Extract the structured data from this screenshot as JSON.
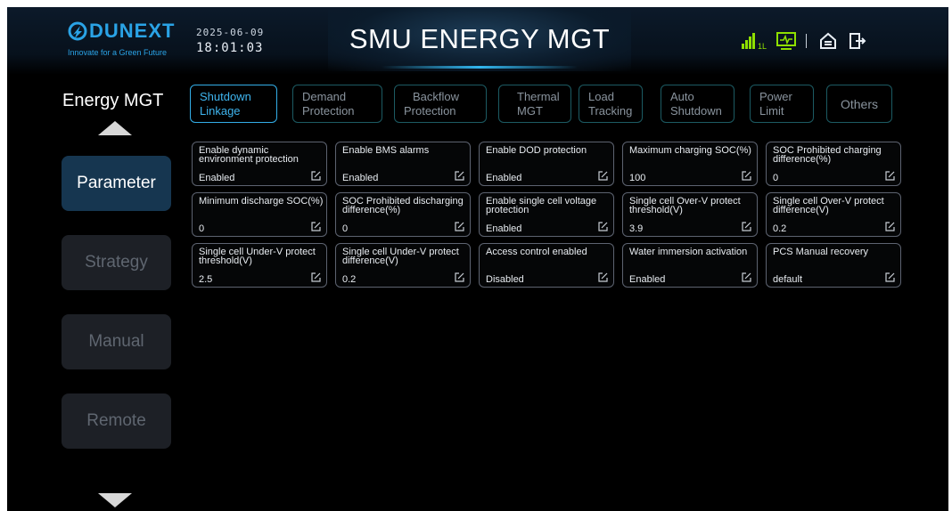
{
  "header": {
    "brand": "DUNEXT",
    "slogan": "Innovate for a Green Future",
    "date": "2025-06-09",
    "time": "18:01:03",
    "title": "SMU ENERGY MGT",
    "signal_label": "1L",
    "icons": [
      "signal-icon",
      "monitor-icon",
      "home-icon",
      "exit-icon"
    ],
    "accent_color": "#2aa3e6",
    "signal_color": "#8fe000"
  },
  "sidebar": {
    "title": "Energy MGT",
    "items": [
      {
        "label": "Parameter",
        "active": true
      },
      {
        "label": "Strategy",
        "active": false
      },
      {
        "label": "Manual",
        "active": false
      },
      {
        "label": "Remote",
        "active": false
      }
    ]
  },
  "tabs": [
    {
      "line1": "Shutdown",
      "line2": "Linkage",
      "active": true
    },
    {
      "line1": "Demand",
      "line2": "Protection",
      "active": false
    },
    {
      "line1": "Backflow",
      "line2": "Protection",
      "active": false
    },
    {
      "line1": "Thermal",
      "line2": "MGT",
      "active": false
    },
    {
      "line1": "Load",
      "line2": "Tracking",
      "active": false
    },
    {
      "line1": "Auto",
      "line2": "Shutdown",
      "active": false
    },
    {
      "line1": "Power",
      "line2": "Limit",
      "active": false
    },
    {
      "line1": "Others",
      "line2": "",
      "active": false
    }
  ],
  "params": [
    {
      "label": "Enable dynamic environment protection",
      "value": "Enabled"
    },
    {
      "label": "Enable BMS alarms",
      "value": "Enabled"
    },
    {
      "label": "Enable DOD protection",
      "value": "Enabled"
    },
    {
      "label": "Maximum charging SOC(%)",
      "value": "100"
    },
    {
      "label": "SOC Prohibited charging difference(%)",
      "value": "0"
    },
    {
      "label": "Minimum discharge SOC(%)",
      "value": "0"
    },
    {
      "label": "SOC Prohibited discharging difference(%)",
      "value": "0"
    },
    {
      "label": "Enable single cell voltage protection",
      "value": "Enabled"
    },
    {
      "label": "Single cell Over-V protect threshold(V)",
      "value": "3.9"
    },
    {
      "label": "Single cell Over-V protect difference(V)",
      "value": "0.2"
    },
    {
      "label": "Single cell Under-V protect threshold(V)",
      "value": "2.5"
    },
    {
      "label": "Single cell Under-V protect difference(V)",
      "value": "0.2"
    },
    {
      "label": "Access control enabled",
      "value": "Disabled"
    },
    {
      "label": "Water immersion activation",
      "value": "Enabled"
    },
    {
      "label": "PCS Manual recovery",
      "value": "default"
    }
  ]
}
